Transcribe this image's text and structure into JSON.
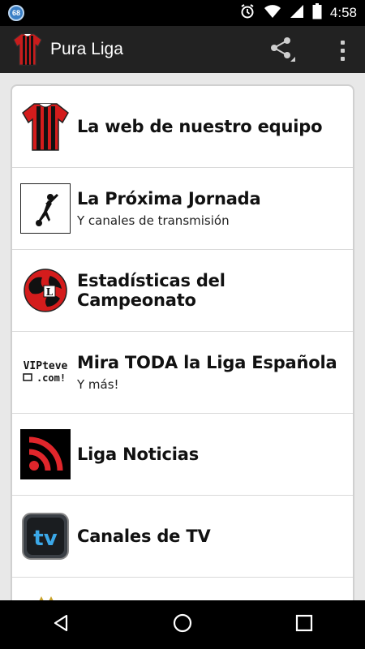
{
  "status_bar": {
    "notification_badge": "68",
    "time": "4:58"
  },
  "action_bar": {
    "title": "Pura Liga"
  },
  "menu_items": [
    {
      "title": "La web de nuestro equipo",
      "subtitle": ""
    },
    {
      "title": "La Próxima Jornada",
      "subtitle": "Y canales de transmisión"
    },
    {
      "title": "Estadísticas del Campeonato",
      "subtitle": ""
    },
    {
      "title": "Mira TODA la Liga Española",
      "subtitle": "Y más!",
      "icon_text": "VIPteve .com!"
    },
    {
      "title": "Liga Noticias",
      "subtitle": ""
    },
    {
      "title": "Canales de TV",
      "subtitle": "",
      "icon_text": "tv"
    }
  ],
  "colors": {
    "accent_red": "#d41c1c",
    "action_bar": "#222222",
    "status_bar": "#000000"
  }
}
